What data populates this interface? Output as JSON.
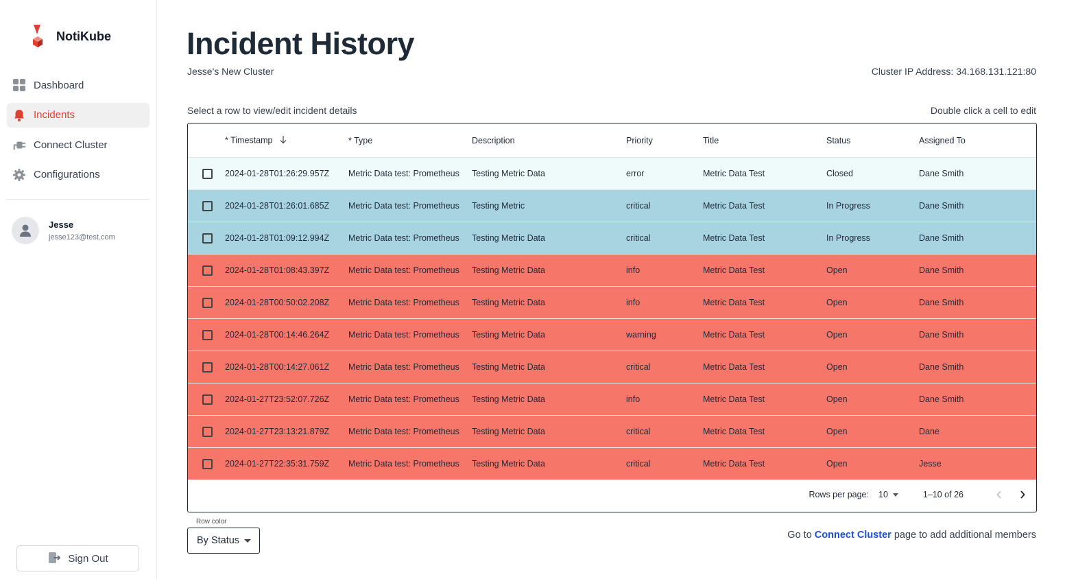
{
  "brand": {
    "name": "NotiKube"
  },
  "sidebar": {
    "items": [
      {
        "label": "Dashboard",
        "icon": "dashboard-icon",
        "active": false
      },
      {
        "label": "Incidents",
        "icon": "bell-icon",
        "active": true
      },
      {
        "label": "Connect Cluster",
        "icon": "plug-icon",
        "active": false
      },
      {
        "label": "Configurations",
        "icon": "gear-icon",
        "active": false
      }
    ],
    "user": {
      "name": "Jesse",
      "email": "jesse123@test.com"
    },
    "signout_label": "Sign Out"
  },
  "header": {
    "title": "Incident History",
    "cluster_name": "Jesse's New Cluster",
    "cluster_ip": "Cluster IP Address: 34.168.131.121:80",
    "hint_left": "Select a row to view/edit incident details",
    "hint_right": "Double click a cell to edit"
  },
  "table": {
    "columns": [
      "* Timestamp",
      "* Type",
      "Description",
      "Priority",
      "Title",
      "Status",
      "Assigned To"
    ],
    "rows": [
      {
        "timestamp": "2024-01-28T01:26:29.957Z",
        "type": "Metric Data test: Prometheus",
        "description": "Testing Metric Data",
        "priority": "error",
        "title": "Metric Data Test",
        "status": "Closed",
        "assigned": "Dane Smith"
      },
      {
        "timestamp": "2024-01-28T01:26:01.685Z",
        "type": "Metric Data test: Prometheus",
        "description": "Testing Metric",
        "priority": "critical",
        "title": "Metric Data Test",
        "status": "In Progress",
        "assigned": "Dane Smith"
      },
      {
        "timestamp": "2024-01-28T01:09:12.994Z",
        "type": "Metric Data test: Prometheus",
        "description": "Testing Metric Data",
        "priority": "critical",
        "title": "Metric Data Test",
        "status": "In Progress",
        "assigned": "Dane Smith"
      },
      {
        "timestamp": "2024-01-28T01:08:43.397Z",
        "type": "Metric Data test: Prometheus",
        "description": "Testing Metric Data",
        "priority": "info",
        "title": "Metric Data Test",
        "status": "Open",
        "assigned": "Dane Smith"
      },
      {
        "timestamp": "2024-01-28T00:50:02.208Z",
        "type": "Metric Data test: Prometheus",
        "description": "Testing Metric Data",
        "priority": "info",
        "title": "Metric Data Test",
        "status": "Open",
        "assigned": "Dane Smith"
      },
      {
        "timestamp": "2024-01-28T00:14:46.264Z",
        "type": "Metric Data test: Prometheus",
        "description": "Testing Metric Data",
        "priority": "warning",
        "title": "Metric Data Test",
        "status": "Open",
        "assigned": "Dane Smith"
      },
      {
        "timestamp": "2024-01-28T00:14:27.061Z",
        "type": "Metric Data test: Prometheus",
        "description": "Testing Metric Data",
        "priority": "critical",
        "title": "Metric Data Test",
        "status": "Open",
        "assigned": "Dane Smith"
      },
      {
        "timestamp": "2024-01-27T23:52:07.726Z",
        "type": "Metric Data test: Prometheus",
        "description": "Testing Metric Data",
        "priority": "info",
        "title": "Metric Data Test",
        "status": "Open",
        "assigned": "Dane Smith"
      },
      {
        "timestamp": "2024-01-27T23:13:21.879Z",
        "type": "Metric Data test: Prometheus",
        "description": "Testing Metric Data",
        "priority": "critical",
        "title": "Metric Data Test",
        "status": "Open",
        "assigned": "Dane"
      },
      {
        "timestamp": "2024-01-27T22:35:31.759Z",
        "type": "Metric Data test: Prometheus",
        "description": "Testing Metric Data",
        "priority": "critical",
        "title": "Metric Data Test",
        "status": "Open",
        "assigned": "Jesse"
      }
    ],
    "pagination": {
      "rows_per_page_label": "Rows per page:",
      "rows_per_page": "10",
      "range": "1–10 of 26"
    }
  },
  "row_color": {
    "label": "Row color",
    "value": "By Status"
  },
  "footer": {
    "prefix": "Go to",
    "link": "Connect Cluster",
    "suffix": "page to add additional members"
  },
  "colors": {
    "accent": "#e0402f",
    "closed_row": "#effbfb",
    "in_progress_row": "#a8d4e2",
    "open_row": "#f7766a",
    "link": "#1d4fd8"
  }
}
